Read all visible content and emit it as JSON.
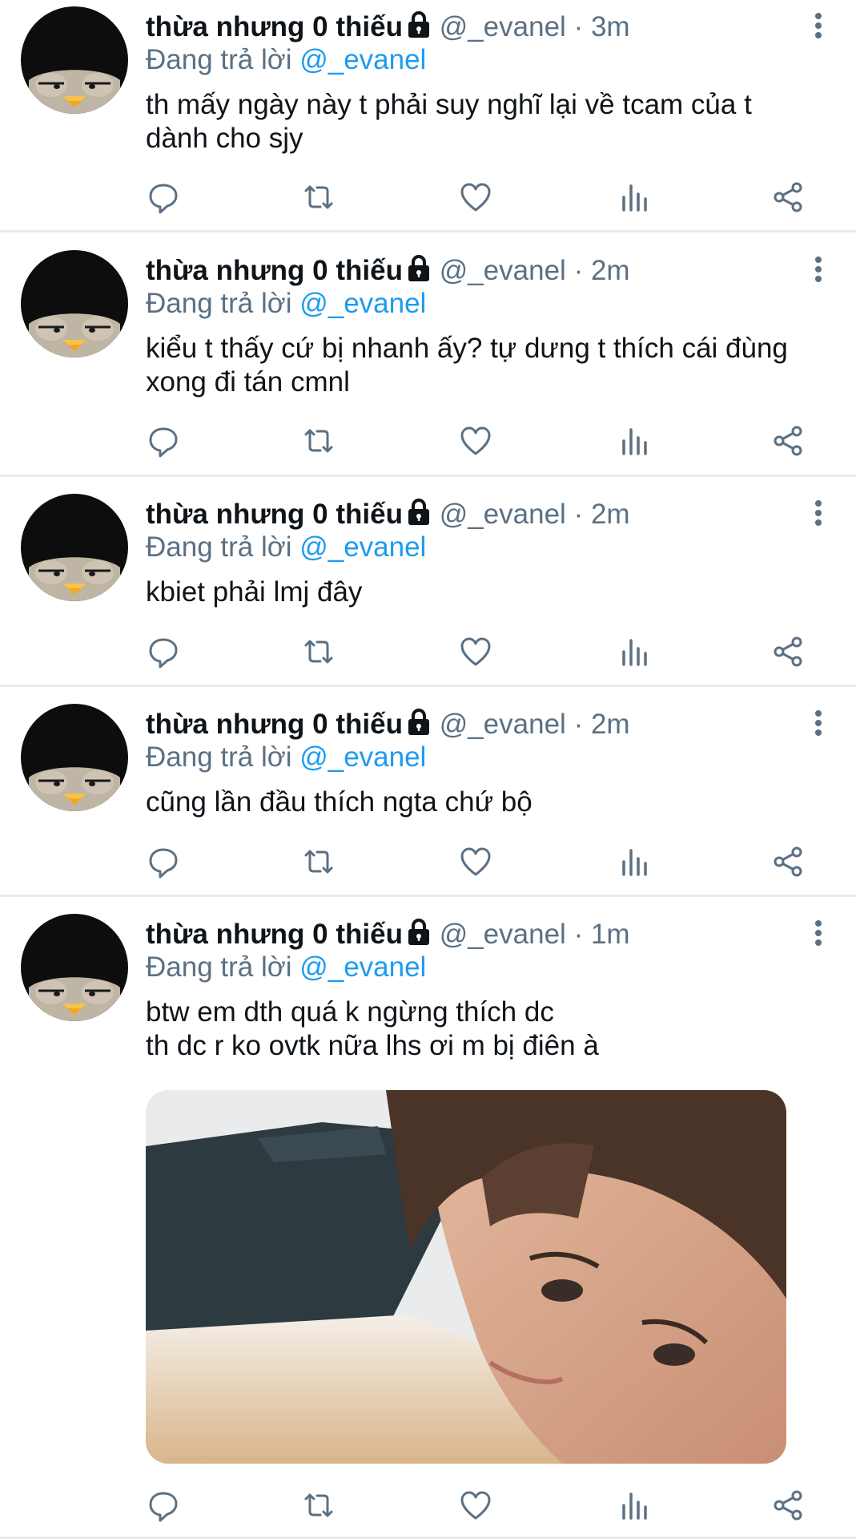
{
  "colors": {
    "text": "#0f1419",
    "secondary": "#5b7083",
    "link": "#1d9bf0",
    "divider": "#e9ecef",
    "icon": "#5b7083"
  },
  "tweets": [
    {
      "name": "thừa nhưng 0 thiếu",
      "handle": "@_evanel",
      "separator": "·",
      "time": "3m",
      "reply_prefix": "Đang trả lời",
      "reply_to": "@_evanel",
      "lines": [
        "th mấy ngày này t phải suy nghĩ lại về tcam của t",
        "dành cho sjy"
      ]
    },
    {
      "name": "thừa nhưng 0 thiếu",
      "handle": "@_evanel",
      "separator": "·",
      "time": "2m",
      "reply_prefix": "Đang trả lời",
      "reply_to": "@_evanel",
      "lines": [
        "kiểu t thấy cứ bị nhanh ấy? tự dưng t thích cái đùng",
        "xong đi tán cmnl"
      ]
    },
    {
      "name": "thừa nhưng 0 thiếu",
      "handle": "@_evanel",
      "separator": "·",
      "time": "2m",
      "reply_prefix": "Đang trả lời",
      "reply_to": "@_evanel",
      "lines": [
        "kbiet phải lmj đây"
      ]
    },
    {
      "name": "thừa nhưng 0 thiếu",
      "handle": "@_evanel",
      "separator": "·",
      "time": "2m",
      "reply_prefix": "Đang trả lời",
      "reply_to": "@_evanel",
      "lines": [
        "cũng lần đầu thích ngta chứ bộ"
      ]
    },
    {
      "name": "thừa nhưng 0 thiếu",
      "handle": "@_evanel",
      "separator": "·",
      "time": "1m",
      "reply_prefix": "Đang trả lời",
      "reply_to": "@_evanel",
      "lines": [
        "btw em dth quá k ngừng thích dc",
        "th dc r ko ovtk nữa lhs ơi m bị điên à"
      ],
      "has_media": true
    }
  ],
  "icons": {
    "avatar": "penguin-avatar-icon",
    "lock": "lock-icon",
    "more": "more-vertical-icon",
    "actions": [
      "reply-icon",
      "retweet-icon",
      "like-icon",
      "analytics-icon",
      "share-icon"
    ]
  }
}
